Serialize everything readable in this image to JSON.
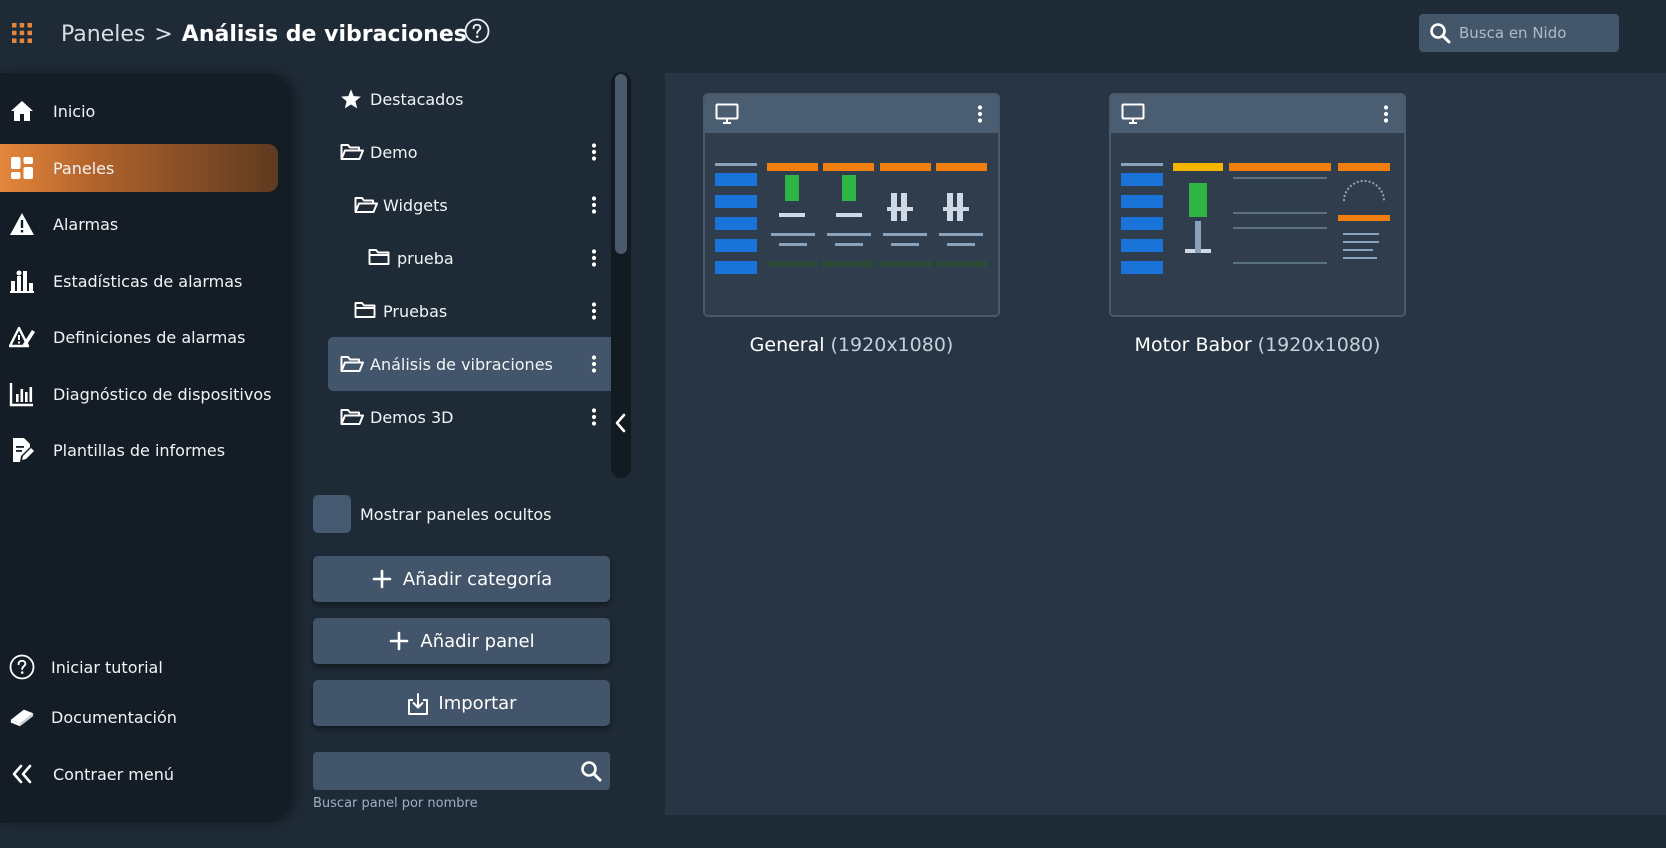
{
  "colors": {
    "accent": "#e4863d",
    "background": "#1e2a36",
    "sidebar": "#141d25",
    "surface": "#43556a",
    "main_area": "#273545"
  },
  "topbar": {
    "apps_icon": "apps-grid-icon",
    "breadcrumb_parent": "Paneles",
    "breadcrumb_separator": ">",
    "breadcrumb_current": "Análisis de vibraciones",
    "help_icon": "help-circle-icon",
    "search_placeholder": "Busca en Nido"
  },
  "sidebar": {
    "items": [
      {
        "label": "Inicio",
        "icon": "home-icon",
        "active": false
      },
      {
        "label": "Paneles",
        "icon": "dashboard-icon",
        "active": true
      },
      {
        "label": "Alarmas",
        "icon": "warning-icon",
        "active": false
      },
      {
        "label": "Estadísticas de alarmas",
        "icon": "alarm-stats-icon",
        "active": false
      },
      {
        "label": "Definiciones de alarmas",
        "icon": "alarm-definitions-icon",
        "active": false
      },
      {
        "label": "Diagnóstico de dispositivos",
        "icon": "device-diagnostics-icon",
        "active": false
      },
      {
        "label": "Plantillas de informes",
        "icon": "report-templates-icon",
        "active": false
      }
    ],
    "bottom_items": [
      {
        "label": "Iniciar tutorial",
        "icon": "help-circle-icon"
      },
      {
        "label": "Documentación",
        "icon": "book-icon"
      },
      {
        "label": "Contraer menú",
        "icon": "double-chevron-left-icon"
      }
    ]
  },
  "folders": {
    "items": [
      {
        "label": "Destacados",
        "icon": "star-icon",
        "depth": 0,
        "selected": false,
        "has_menu": false
      },
      {
        "label": "Demo",
        "icon": "folder-open-icon",
        "depth": 0,
        "selected": false,
        "has_menu": true
      },
      {
        "label": "Widgets",
        "icon": "folder-open-icon",
        "depth": 1,
        "selected": false,
        "has_menu": true
      },
      {
        "label": "prueba",
        "icon": "folder-icon",
        "depth": 2,
        "selected": false,
        "has_menu": true
      },
      {
        "label": "Pruebas",
        "icon": "folder-icon",
        "depth": 1,
        "selected": false,
        "has_menu": true
      },
      {
        "label": "Análisis de vibraciones",
        "icon": "folder-open-icon",
        "depth": 0,
        "selected": true,
        "has_menu": true
      },
      {
        "label": "Demos 3D",
        "icon": "folder-open-icon",
        "depth": 0,
        "selected": false,
        "has_menu": true
      }
    ],
    "show_hidden_label": "Mostrar paneles ocultos",
    "show_hidden_checked": false,
    "add_category_label": "Añadir categoría",
    "add_panel_label": "Añadir panel",
    "import_label": "Importar",
    "search_value": "",
    "search_hint": "Buscar panel por nombre"
  },
  "dashboards": [
    {
      "name": "General",
      "resolution": "(1920x1080)",
      "icon": "monitor-icon"
    },
    {
      "name": "Motor Babor",
      "resolution": "(1920x1080)",
      "icon": "monitor-icon"
    }
  ]
}
